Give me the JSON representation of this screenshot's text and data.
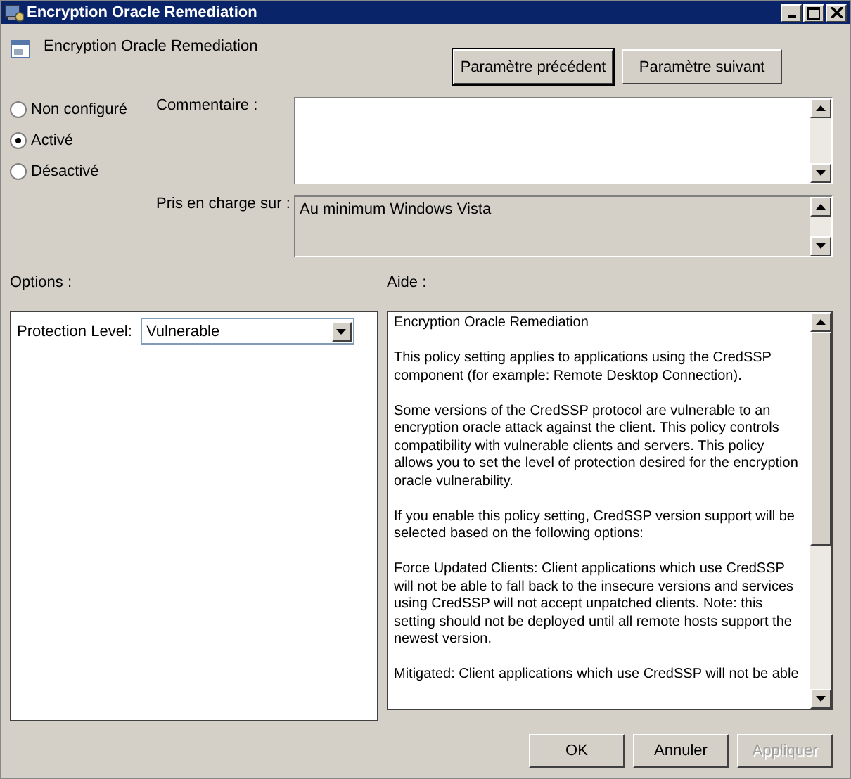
{
  "window": {
    "title": "Encryption Oracle Remediation"
  },
  "header": {
    "title": "Encryption Oracle Remediation"
  },
  "nav_buttons": [
    {
      "label": "Paramètre précédent",
      "focused": true
    },
    {
      "label": "Paramètre suivant",
      "focused": false
    }
  ],
  "state_options": [
    {
      "label": "Non configuré",
      "selected": false
    },
    {
      "label": "Activé",
      "selected": true
    },
    {
      "label": "Désactivé",
      "selected": false
    }
  ],
  "comment": {
    "label": "Commentaire :"
  },
  "supported_on": {
    "label": "Pris en charge sur :",
    "value": "Au minimum Windows Vista"
  },
  "options": {
    "label": "Options :",
    "field_label": "Protection Level:",
    "value": "Vulnerable"
  },
  "help": {
    "label": "Aide :",
    "paragraphs": [
      "Encryption Oracle Remediation",
      "This policy setting applies to applications using the CredSSP component (for example: Remote Desktop Connection).",
      "Some versions of the CredSSP protocol are vulnerable to an encryption oracle attack against the client.  This policy controls compatibility with vulnerable clients and servers.  This policy allows you to set the level of protection desired for the encryption oracle vulnerability.",
      "If you enable this policy setting, CredSSP version support will be selected based on the following options:",
      "Force Updated Clients: Client applications which use CredSSP will not be able to fall back to the insecure versions and services using CredSSP will not accept unpatched clients. Note: this setting should not be deployed until all remote hosts support the newest version.",
      "Mitigated: Client applications which use CredSSP will not be able"
    ]
  },
  "buttons": [
    {
      "label": "OK",
      "disabled": false
    },
    {
      "label": "Annuler",
      "disabled": false
    },
    {
      "label": "Appliquer",
      "disabled": true
    }
  ]
}
